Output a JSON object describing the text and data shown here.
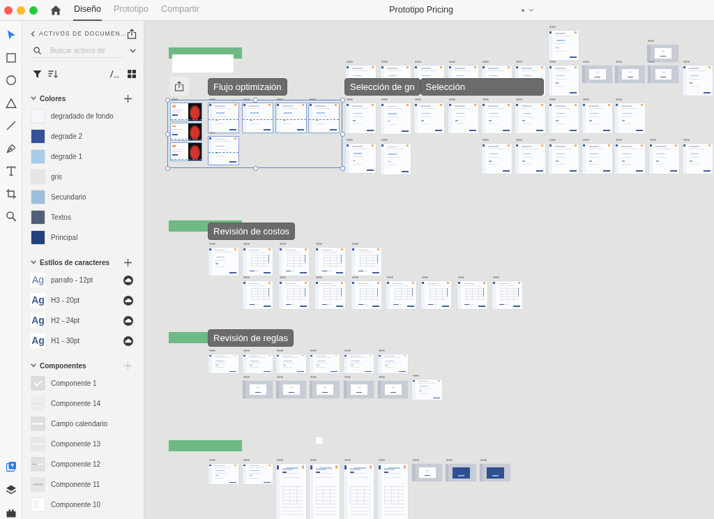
{
  "window": {
    "title": "Prototipo Pricing",
    "tabs": [
      {
        "label": "Diseño",
        "selected": true
      },
      {
        "label": "Prototipo",
        "selected": false
      },
      {
        "label": "Compartir",
        "selected": false
      }
    ]
  },
  "toolbar": {
    "tools": [
      {
        "selected": true
      },
      {
        "selected": false
      },
      {
        "selected": false
      },
      {
        "selected": false
      },
      {
        "selected": false
      },
      {
        "selected": false
      },
      {
        "selected": false
      },
      {
        "selected": false
      },
      {
        "selected": false
      }
    ],
    "panels": [
      {
        "selected": true
      },
      {
        "selected": false
      },
      {
        "selected": false
      }
    ]
  },
  "assets": {
    "title": "ACTIVOS DE DOCUMEN…",
    "search": {
      "placeholder": "Buscar activos de"
    },
    "sections": [
      {
        "kind": "colors",
        "title": "Colores",
        "expanded": true,
        "add_disabled": false,
        "items": [
          {
            "label": "degradado de fondo",
            "color": "#f4f6fb"
          },
          {
            "label": "degrade 2",
            "color": "#34539a"
          },
          {
            "label": "degrade 1",
            "color": "#a8cbea"
          },
          {
            "label": "gris",
            "color": "#e6e6e6"
          },
          {
            "label": "Secundario",
            "color": "#9dbfdd"
          },
          {
            "label": "Textos",
            "color": "#525f78"
          },
          {
            "label": "Principal",
            "color": "#22427b"
          }
        ]
      },
      {
        "kind": "styles",
        "title": "Estilos de caracteres",
        "expanded": true,
        "add_disabled": false,
        "items": [
          {
            "preview": "Ag",
            "label": "parrafo - 12pt"
          },
          {
            "preview": "Ag",
            "label": "H3 - 20pt"
          },
          {
            "preview": "Ag",
            "label": "H2 - 24pt"
          },
          {
            "preview": "Ag",
            "label": "H1 - 30pt"
          }
        ]
      },
      {
        "kind": "components",
        "title": "Componentes",
        "expanded": true,
        "add_disabled": true,
        "items": [
          {
            "kind": "check",
            "label": "Componente 1"
          },
          {
            "kind": "dashes",
            "label": "Componente 14"
          },
          {
            "kind": "field",
            "label": "Campo calendario"
          },
          {
            "kind": "line",
            "label": "Componente 13"
          },
          {
            "kind": "slider",
            "label": "Componente 12"
          },
          {
            "kind": "bar",
            "label": "Componente 11"
          },
          {
            "kind": "card",
            "label": "Componente 10"
          }
        ]
      }
    ]
  },
  "canvas": {
    "sections": [
      {
        "flow_labels": [
          "Flujo optimizaión",
          "Selección de gn",
          "Selección"
        ],
        "artboards": [
          {
            "kind": "photo",
            "selected": true
          },
          {
            "kind": "photo",
            "selected": true
          },
          {
            "kind": "photo",
            "selected": true
          },
          {
            "kind": "screen",
            "selected": true
          },
          {
            "kind": "screen",
            "selected": true
          },
          {
            "kind": "screen",
            "selected": true
          },
          {
            "kind": "screen",
            "selected": true
          },
          {
            "kind": "screen",
            "selected": true
          },
          {
            "kind": "screen",
            "selected": false
          },
          {
            "kind": "modal",
            "selected": false
          },
          {
            "kind": "screen",
            "selected": false
          },
          {
            "kind": "screen",
            "selected": false
          },
          {
            "kind": "screen",
            "selected": false
          },
          {
            "kind": "screen",
            "selected": false
          },
          {
            "kind": "screen",
            "selected": false
          },
          {
            "kind": "screen",
            "selected": false
          },
          {
            "kind": "screen",
            "selected": false
          },
          {
            "kind": "modal",
            "selected": false
          },
          {
            "kind": "modal",
            "selected": false
          },
          {
            "kind": "modal",
            "selected": false
          },
          {
            "kind": "screen",
            "selected": false
          },
          {
            "kind": "screen",
            "selected": false
          },
          {
            "kind": "screen",
            "selected": false
          },
          {
            "kind": "screen",
            "selected": false
          },
          {
            "kind": "screen",
            "selected": false
          },
          {
            "kind": "screen",
            "selected": false
          },
          {
            "kind": "screen",
            "selected": false
          },
          {
            "kind": "screen",
            "selected": false
          },
          {
            "kind": "screen",
            "selected": false
          },
          {
            "kind": "screen",
            "selected": false
          },
          {
            "kind": "screen",
            "selected": false
          },
          {
            "kind": "screen",
            "selected": false
          },
          {
            "kind": "screen",
            "selected": false
          },
          {
            "kind": "screen",
            "selected": false
          },
          {
            "kind": "screen",
            "selected": false
          },
          {
            "kind": "screen",
            "selected": false
          },
          {
            "kind": "screen",
            "selected": false
          },
          {
            "kind": "screen",
            "selected": false
          },
          {
            "kind": "screen",
            "selected": false
          }
        ]
      },
      {
        "flow_labels": [
          "Revisión de costos"
        ],
        "artboards": [
          {
            "kind": "screen",
            "selected": false
          },
          {
            "kind": "table",
            "selected": false
          },
          {
            "kind": "table",
            "selected": false
          },
          {
            "kind": "table",
            "selected": false
          },
          {
            "kind": "table",
            "selected": false
          },
          {
            "kind": "table",
            "selected": false
          },
          {
            "kind": "table",
            "selected": false
          },
          {
            "kind": "table",
            "selected": false
          },
          {
            "kind": "table",
            "selected": false
          },
          {
            "kind": "table",
            "selected": false
          },
          {
            "kind": "table",
            "selected": false
          },
          {
            "kind": "table",
            "selected": false
          },
          {
            "kind": "table",
            "selected": false
          }
        ]
      },
      {
        "flow_labels": [
          "Revisión de reglas"
        ],
        "artboards": [
          {
            "kind": "screen",
            "selected": false
          },
          {
            "kind": "screen",
            "selected": false
          },
          {
            "kind": "screen",
            "selected": false
          },
          {
            "kind": "screen",
            "selected": false
          },
          {
            "kind": "screen",
            "selected": false
          },
          {
            "kind": "screen",
            "selected": false
          },
          {
            "kind": "modal",
            "selected": false
          },
          {
            "kind": "modal",
            "selected": false
          },
          {
            "kind": "modal",
            "selected": false
          },
          {
            "kind": "modal",
            "selected": false
          },
          {
            "kind": "modal",
            "selected": false
          },
          {
            "kind": "screen",
            "selected": false
          }
        ]
      },
      {
        "artboards": [
          {
            "kind": "screen",
            "selected": false
          },
          {
            "kind": "screen",
            "selected": false
          },
          {
            "kind": "long",
            "selected": false
          },
          {
            "kind": "long",
            "selected": false
          },
          {
            "kind": "long",
            "selected": false
          },
          {
            "kind": "long",
            "selected": false
          },
          {
            "kind": "modal",
            "selected": false
          },
          {
            "kind": "dark-modal",
            "selected": false
          },
          {
            "kind": "dark-modal",
            "selected": false
          }
        ]
      }
    ]
  }
}
